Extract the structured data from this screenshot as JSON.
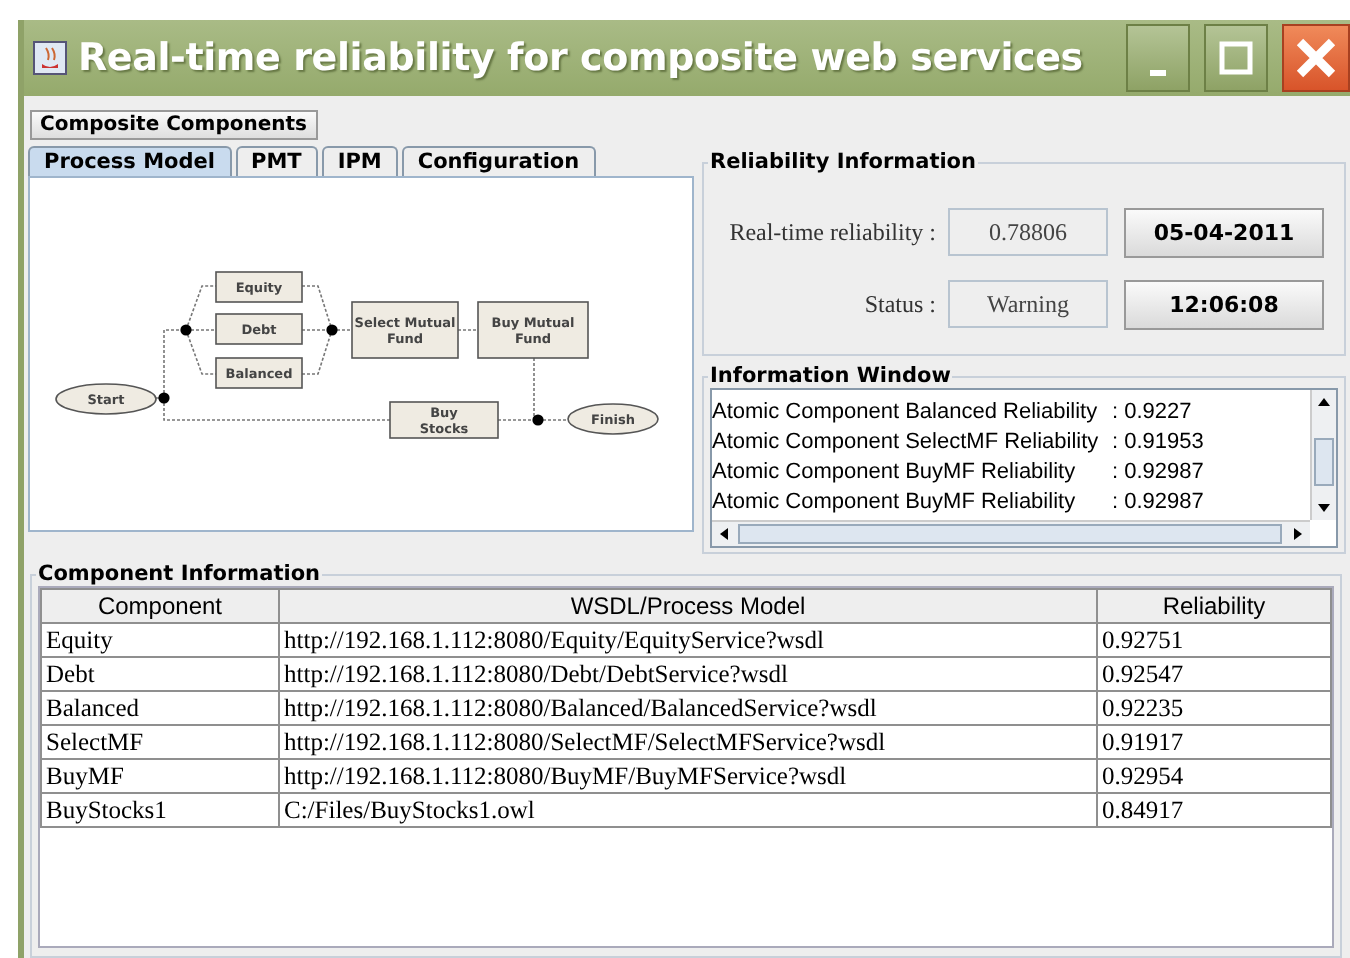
{
  "window": {
    "title": "Real-time reliability for composite web services"
  },
  "menu": {
    "label": "Composite Components"
  },
  "tabs": [
    {
      "label": "Process Model",
      "selected": true
    },
    {
      "label": "PMT",
      "selected": false
    },
    {
      "label": "IPM",
      "selected": false
    },
    {
      "label": "Configuration",
      "selected": false
    }
  ],
  "process_model": {
    "nodes": [
      {
        "label": "Start",
        "kind": "event"
      },
      {
        "label": "Equity",
        "kind": "task"
      },
      {
        "label": "Debt",
        "kind": "task"
      },
      {
        "label": "Balanced",
        "kind": "task"
      },
      {
        "label": "Select Mutual Fund",
        "kind": "task"
      },
      {
        "label": "Buy Mutual Fund",
        "kind": "task"
      },
      {
        "label": "Buy Stocks",
        "kind": "task"
      },
      {
        "label": "Finish",
        "kind": "event"
      }
    ]
  },
  "reliability_information": {
    "title": "Reliability Information",
    "reliability_label": "Real-time reliability :",
    "reliability_value": "0.78806",
    "status_label": "Status :",
    "status_value": "Warning",
    "date": "05-04-2011",
    "time": "12:06:08"
  },
  "information_window": {
    "title": "Information Window",
    "lines": [
      {
        "text": "Atomic Component Balanced Reliability",
        "value": ": 0.9227"
      },
      {
        "text": "Atomic Component SelectMF Reliability",
        "value": ": 0.91953"
      },
      {
        "text": "Atomic Component BuyMF Reliability",
        "value": ": 0.92987"
      },
      {
        "text": "Atomic Component BuyMF Reliability",
        "value": ": 0.92987"
      }
    ]
  },
  "component_information": {
    "title": "Component Information",
    "columns": [
      "Component",
      "WSDL/Process Model",
      "Reliability"
    ],
    "rows": [
      [
        "Equity",
        "http://192.168.1.112:8080/Equity/EquityService?wsdl",
        "0.92751"
      ],
      [
        "Debt",
        "http://192.168.1.112:8080/Debt/DebtService?wsdl",
        "0.92547"
      ],
      [
        "Balanced",
        "http://192.168.1.112:8080/Balanced/BalancedService?wsdl",
        "0.92235"
      ],
      [
        "SelectMF",
        "http://192.168.1.112:8080/SelectMF/SelectMFService?wsdl",
        "0.91917"
      ],
      [
        "BuyMF",
        "http://192.168.1.112:8080/BuyMF/BuyMFService?wsdl",
        "0.92954"
      ],
      [
        "BuyStocks1",
        "C:/Files/BuyStocks1.owl",
        "0.84917"
      ]
    ]
  }
}
